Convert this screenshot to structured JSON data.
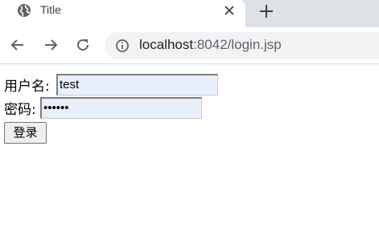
{
  "tab": {
    "title": "Title",
    "favicon": "globe-icon",
    "close_icon": "close-icon"
  },
  "new_tab_icon": "plus-icon",
  "toolbar": {
    "back_icon": "back-arrow-icon",
    "forward_icon": "forward-arrow-icon",
    "reload_icon": "reload-icon",
    "site_info_icon": "info-icon",
    "url_host": "localhost",
    "url_path": ":8042/login.jsp"
  },
  "form": {
    "username_label": "用户名:",
    "username_value": "test",
    "password_label": "密码:",
    "password_value": "••••••",
    "submit_label": "登录"
  },
  "colors": {
    "tabstrip": "#dee1e6",
    "omnibox": "#f1f3f4",
    "autofill": "#e8f0fe"
  }
}
